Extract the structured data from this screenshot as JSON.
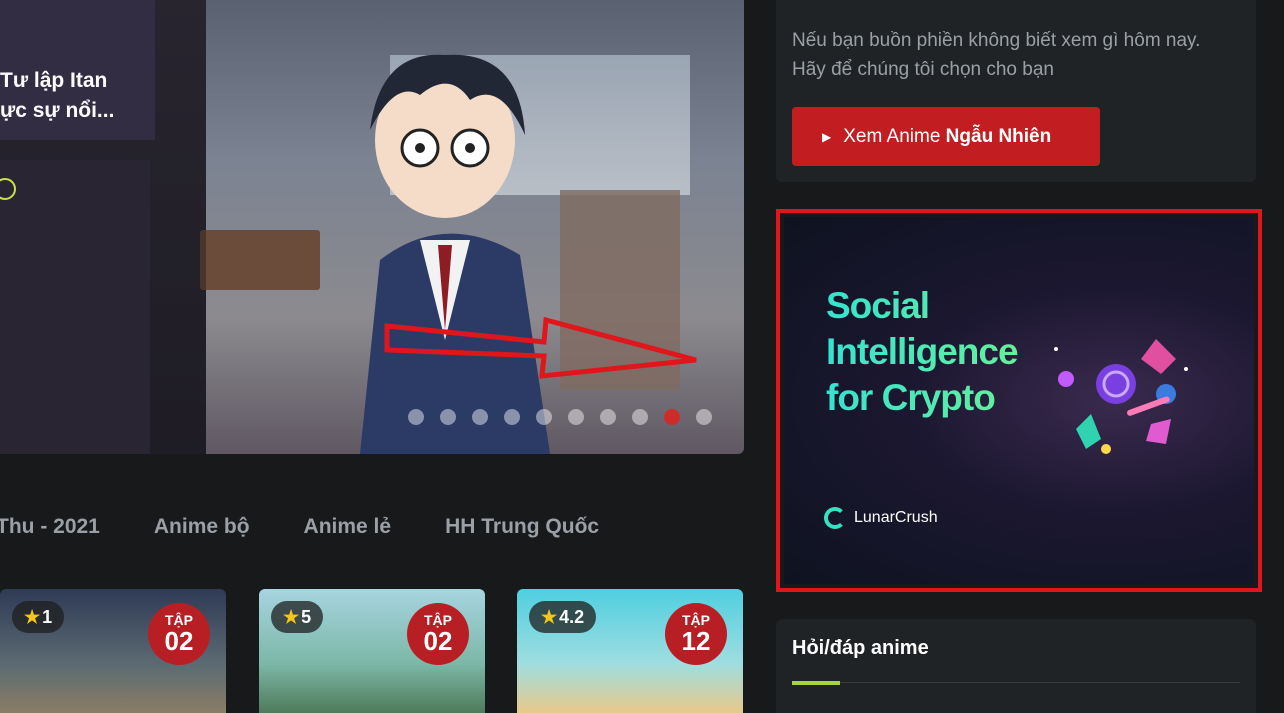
{
  "hero": {
    "title_line1": "Tư lập Itan",
    "title_line2": "ực sự nổi...",
    "dots_count": 10,
    "active_dot": 9
  },
  "tabs": [
    "Thu - 2021",
    "Anime bộ",
    "Anime lẻ",
    "HH Trung Quốc"
  ],
  "cards": [
    {
      "rating": "1",
      "ep_label": "TẬP",
      "ep_number": "02",
      "color": "#3d4a66"
    },
    {
      "rating": "5",
      "ep_label": "TẬP",
      "ep_number": "02",
      "color": "#6fb3c9"
    },
    {
      "rating": "4.2",
      "ep_label": "TẬP",
      "ep_number": "12",
      "color": "#47c4d6"
    }
  ],
  "sidebar": {
    "random_desc": "Nếu bạn buồn phiền không biết xem gì hôm nay. Hãy để chúng tôi chọn cho bạn",
    "random_btn_prefix": "Xem Anime",
    "random_btn_bold": "Ngẫu Nhiên",
    "ad": {
      "headline_1": "Social",
      "headline_2": "Intelligence",
      "headline_3": "for Crypto",
      "brand": "LunarCrush"
    },
    "qa_title": "Hỏi/đáp anime"
  },
  "colors": {
    "accent_red": "#c21e21",
    "highlight_border": "#e0161d",
    "underline_green": "#a6d43a",
    "background": "#17191b"
  }
}
